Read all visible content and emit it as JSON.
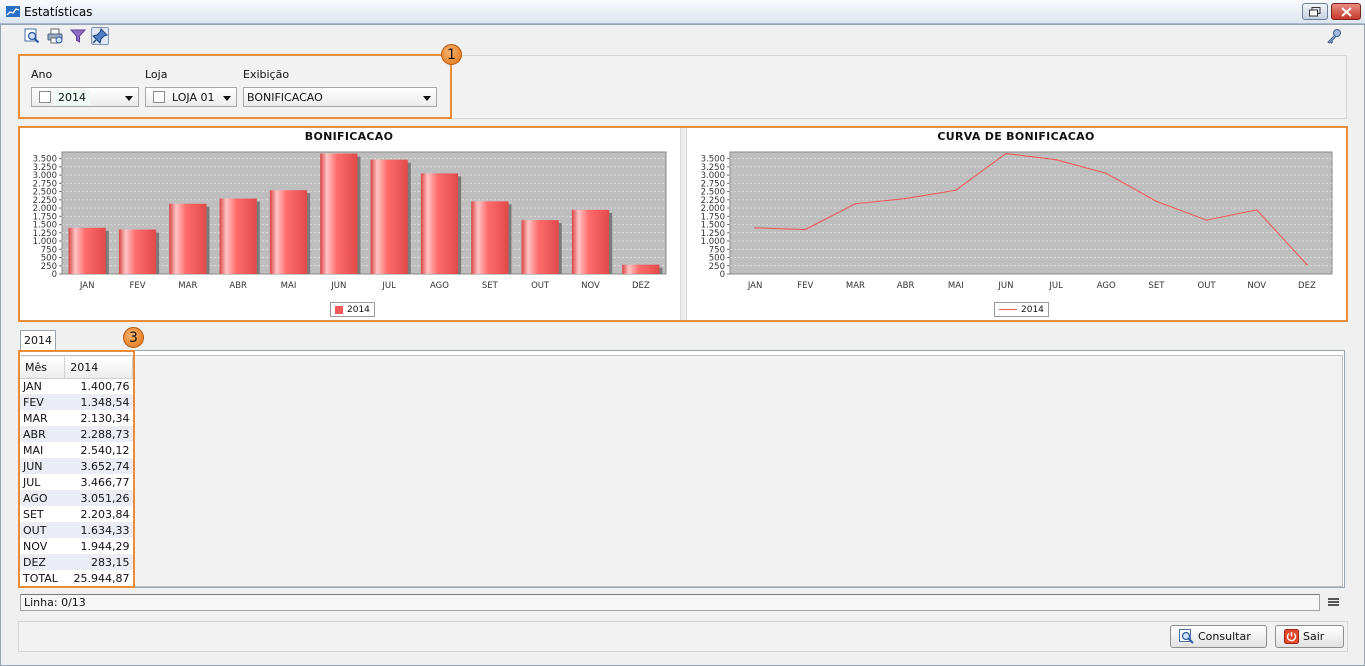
{
  "window": {
    "title": "Estatísticas",
    "app_icon": "chart-icon",
    "restore_icon": "restore-icon",
    "close_icon": "close-icon"
  },
  "toolbar": {
    "icons": [
      "preview-icon",
      "print-icon",
      "filter-icon",
      "pin-icon"
    ],
    "right_icon": "key-icon"
  },
  "filters": {
    "ano_label": "Ano",
    "ano_value": "2014",
    "loja_label": "Loja",
    "loja_value": "LOJA 01",
    "exibicao_label": "Exibição",
    "exibicao_value": "BONIFICACAO"
  },
  "badges": {
    "one": "1",
    "three": "3"
  },
  "chart_data": [
    {
      "type": "bar",
      "title": "BONIFICACAO",
      "categories": [
        "JAN",
        "FEV",
        "MAR",
        "ABR",
        "MAI",
        "JUN",
        "JUL",
        "AGO",
        "SET",
        "OUT",
        "NOV",
        "DEZ"
      ],
      "series": [
        {
          "name": "2014",
          "values": [
            1400.76,
            1348.54,
            2130.34,
            2288.73,
            2540.12,
            3652.74,
            3466.77,
            3051.26,
            2203.84,
            1634.33,
            1944.29,
            283.15
          ]
        }
      ],
      "yticks": [
        "0",
        "250",
        "500",
        "750",
        "1.000",
        "1.250",
        "1.500",
        "1.750",
        "2.000",
        "2.250",
        "2.500",
        "2.750",
        "3.000",
        "3.250",
        "3.500"
      ],
      "ylim": [
        0,
        3700
      ],
      "color": "#f25a5a",
      "grid": true,
      "legend": "bottom-center"
    },
    {
      "type": "line",
      "title": "CURVA DE BONIFICACAO",
      "categories": [
        "JAN",
        "FEV",
        "MAR",
        "ABR",
        "MAI",
        "JUN",
        "JUL",
        "AGO",
        "SET",
        "OUT",
        "NOV",
        "DEZ"
      ],
      "series": [
        {
          "name": "2014",
          "values": [
            1400.76,
            1348.54,
            2130.34,
            2288.73,
            2540.12,
            3652.74,
            3466.77,
            3051.26,
            2203.84,
            1634.33,
            1944.29,
            283.15
          ]
        }
      ],
      "yticks": [
        "0",
        "250",
        "500",
        "750",
        "1.000",
        "1.250",
        "1.500",
        "1.750",
        "2.000",
        "2.250",
        "2.500",
        "2.750",
        "3.000",
        "3.250",
        "3.500"
      ],
      "ylim": [
        0,
        3700
      ],
      "color": "#f25a5a",
      "grid": true,
      "legend": "bottom-center"
    }
  ],
  "tab": {
    "label": "2014"
  },
  "table": {
    "headers": [
      "Mês",
      "2014"
    ],
    "rows": [
      [
        "JAN",
        "1.400,76"
      ],
      [
        "FEV",
        "1.348,54"
      ],
      [
        "MAR",
        "2.130,34"
      ],
      [
        "ABR",
        "2.288,73"
      ],
      [
        "MAI",
        "2.540,12"
      ],
      [
        "JUN",
        "3.652,74"
      ],
      [
        "JUL",
        "3.466,77"
      ],
      [
        "AGO",
        "3.051,26"
      ],
      [
        "SET",
        "2.203,84"
      ],
      [
        "OUT",
        "1.634,33"
      ],
      [
        "NOV",
        "1.944,29"
      ],
      [
        "DEZ",
        "283,15"
      ],
      [
        "TOTAL",
        "25.944,87"
      ]
    ]
  },
  "status": {
    "text": "Linha: 0/13",
    "menu_icon": "menu-icon"
  },
  "buttons": {
    "consultar": "Consultar",
    "consultar_icon": "search-icon",
    "sair": "Sair",
    "sair_icon": "power-icon"
  }
}
